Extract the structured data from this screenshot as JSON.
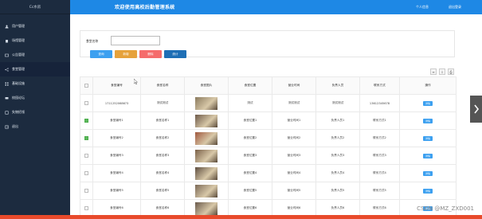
{
  "sidebar": {
    "logo": "Cc水房",
    "items": [
      {
        "label": "用户管理",
        "icon": "users-icon"
      },
      {
        "label": "场馆管理",
        "icon": "building-icon"
      },
      {
        "label": "公告管理",
        "icon": "notice-icon"
      },
      {
        "label": "食堂管理",
        "icon": "share-icon"
      },
      {
        "label": "基础设施",
        "icon": "grid-icon"
      },
      {
        "label": "校园论坛",
        "icon": "forum-icon"
      },
      {
        "label": "失物招领",
        "icon": "lost-icon"
      },
      {
        "label": "退出",
        "icon": "logout-icon"
      }
    ]
  },
  "header": {
    "title": "欢迎使用高校后勤管理系统",
    "profile": "个人信息",
    "logout": "退出登录"
  },
  "search": {
    "label": "食堂名称",
    "placeholder": "",
    "buttons": {
      "query": "查询",
      "add": "新增",
      "delete": "删除",
      "stats": "统计"
    }
  },
  "table": {
    "headers": [
      "",
      "食堂编号",
      "食堂名称",
      "食堂图片",
      "食堂位置",
      "营业时间",
      "负责人员",
      "联系方式",
      "操作"
    ],
    "action_label": "详情",
    "rows": [
      {
        "checked": false,
        "id": "17112520686?3",
        "name": "测试测试",
        "location": "测试",
        "hours": "测试测试",
        "manager": "测试测试",
        "contact": "13612345678"
      },
      {
        "checked": true,
        "id": "食堂编号1",
        "name": "食堂名称1",
        "location": "食堂位置1",
        "hours": "营业时间1",
        "manager": "负责人员1",
        "contact": "联系方式1"
      },
      {
        "checked": true,
        "id": "食堂编号2",
        "name": "食堂名称2",
        "location": "食堂位置2",
        "hours": "营业时间2",
        "manager": "负责人员2",
        "contact": "联系方式2"
      },
      {
        "checked": false,
        "id": "食堂编号3",
        "name": "食堂名称3",
        "location": "食堂位置3",
        "hours": "营业时间3",
        "manager": "负责人员3",
        "contact": "联系方式3"
      },
      {
        "checked": false,
        "id": "食堂编号4",
        "name": "食堂名称4",
        "location": "食堂位置4",
        "hours": "营业时间4",
        "manager": "负责人员4",
        "contact": "联系方式4"
      },
      {
        "checked": false,
        "id": "食堂编号5",
        "name": "食堂名称5",
        "location": "食堂位置5",
        "hours": "营业时间5",
        "manager": "负责人员5",
        "contact": "联系方式5"
      },
      {
        "checked": false,
        "id": "食堂编号6",
        "name": "食堂名称6",
        "location": "食堂位置6",
        "hours": "营业时间6",
        "manager": "负责人员6",
        "contact": "联系方式6"
      }
    ]
  },
  "watermark": "CSDN @MZ_ZXD001",
  "colors": {
    "sidebar_bg": "#1c2b3f",
    "header_bg": "#1e88e5",
    "query_btn": "#3ca0f0",
    "add_btn": "#e6a23c",
    "delete_btn": "#f56c6c",
    "stats_btn": "#1e6fb5",
    "bottom_bar": "#e84a2b"
  }
}
